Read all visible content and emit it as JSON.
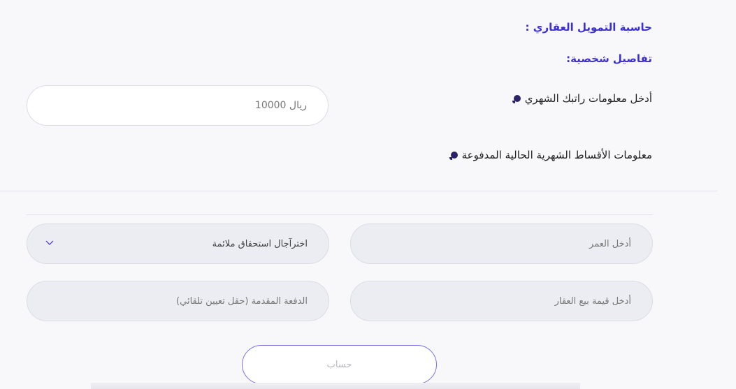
{
  "header": {
    "title": "حاسبة التمويل العقاري :",
    "subtitle": "تفاصيل شخصية:"
  },
  "salary": {
    "label": "أدخل معلومات راتبك الشهري",
    "value": "ريال 10000"
  },
  "installments": {
    "label": "معلومات الأقساط الشهرية الحالية المدفوعة"
  },
  "form": {
    "age_placeholder": "أدخل العمر",
    "maturity_select": "اخترآجال استحقاق ملائمة",
    "price_placeholder": "أدخل قيمة بيع العقار",
    "down_payment_placeholder": "الدفعة المقدمة (حقل تعيين تلقائي)",
    "calculate_label": "حساب"
  },
  "icons": [
    "info-icon",
    "chevron-down-icon"
  ],
  "colors": {
    "accent": "#3b2fd6",
    "field_bg": "#ecedf3",
    "button_border": "#7a72e0"
  }
}
